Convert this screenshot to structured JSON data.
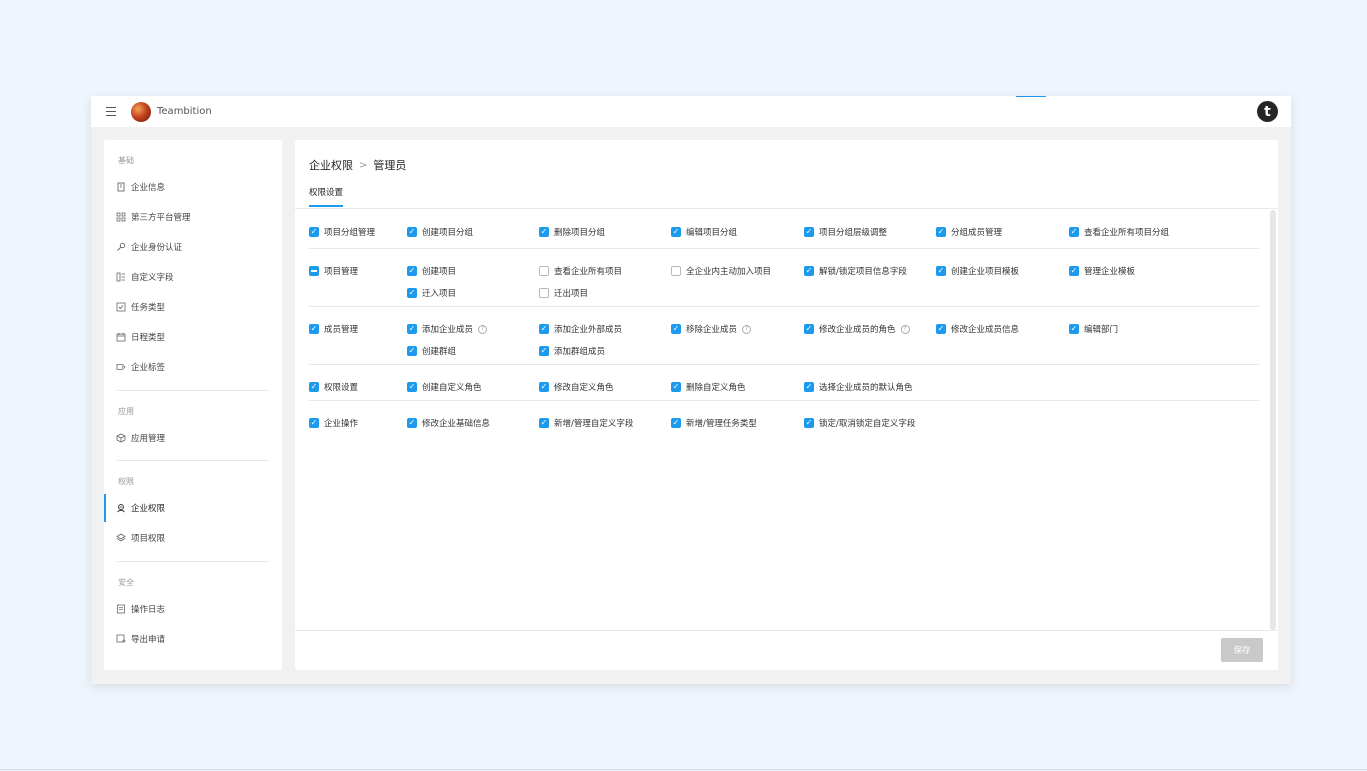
{
  "app": {
    "name": "Teambition",
    "brand_glyph": "t"
  },
  "sidebar": {
    "sections": [
      {
        "title": "基础",
        "items": [
          {
            "label": "企业信息",
            "icon": "building-icon"
          },
          {
            "label": "第三方平台管理",
            "icon": "grid-icon"
          },
          {
            "label": "企业身份认证",
            "icon": "key-icon"
          },
          {
            "label": "自定义字段",
            "icon": "fields-icon"
          },
          {
            "label": "任务类型",
            "icon": "task-check-icon"
          },
          {
            "label": "日程类型",
            "icon": "calendar-icon"
          },
          {
            "label": "企业标签",
            "icon": "tag-icon"
          }
        ]
      },
      {
        "title": "应用",
        "items": [
          {
            "label": "应用管理",
            "icon": "cube-icon"
          }
        ]
      },
      {
        "title": "权限",
        "items": [
          {
            "label": "企业权限",
            "icon": "org-permission-icon",
            "active": true
          },
          {
            "label": "项目权限",
            "icon": "layers-icon"
          }
        ]
      },
      {
        "title": "安全",
        "items": [
          {
            "label": "操作日志",
            "icon": "document-icon"
          },
          {
            "label": "导出申请",
            "icon": "export-icon"
          }
        ]
      }
    ]
  },
  "main": {
    "breadcrumb": {
      "parent": "企业权限",
      "separator": ">",
      "current": "管理员"
    },
    "tab": "权限设置",
    "rows": [
      {
        "group": {
          "label": "项目分组管理",
          "state": "checked"
        },
        "items": [
          {
            "label": "创建项目分组",
            "state": "checked"
          },
          {
            "label": "删除项目分组",
            "state": "checked"
          },
          {
            "label": "编辑项目分组",
            "state": "checked"
          },
          {
            "label": "项目分组层级调整",
            "state": "checked"
          },
          {
            "label": "分组成员管理",
            "state": "checked"
          },
          {
            "label": "查看企业所有项目分组",
            "state": "checked"
          }
        ]
      },
      {
        "group": {
          "label": "项目管理",
          "state": "indeterminate"
        },
        "items": [
          {
            "label": "创建项目",
            "state": "checked"
          },
          {
            "label": "查看企业所有项目",
            "state": "unchecked"
          },
          {
            "label": "全企业内主动加入项目",
            "state": "unchecked"
          },
          {
            "label": "解锁/锁定项目信息字段",
            "state": "checked"
          },
          {
            "label": "创建企业项目模板",
            "state": "checked"
          },
          {
            "label": "管理企业模板",
            "state": "checked"
          },
          {
            "label": "迁入项目",
            "state": "checked"
          },
          {
            "label": "迁出项目",
            "state": "unchecked"
          }
        ]
      },
      {
        "group": {
          "label": "成员管理",
          "state": "checked"
        },
        "items": [
          {
            "label": "添加企业成员",
            "state": "checked",
            "help": true
          },
          {
            "label": "添加企业外部成员",
            "state": "checked"
          },
          {
            "label": "移除企业成员",
            "state": "checked",
            "help": true
          },
          {
            "label": "修改企业成员的角色",
            "state": "checked",
            "help": true
          },
          {
            "label": "修改企业成员信息",
            "state": "checked"
          },
          {
            "label": "编辑部门",
            "state": "checked"
          },
          {
            "label": "创建群组",
            "state": "checked"
          },
          {
            "label": "添加群组成员",
            "state": "checked"
          }
        ]
      },
      {
        "group": {
          "label": "权限设置",
          "state": "checked"
        },
        "items": [
          {
            "label": "创建自定义角色",
            "state": "checked"
          },
          {
            "label": "修改自定义角色",
            "state": "checked"
          },
          {
            "label": "删除自定义角色",
            "state": "checked"
          },
          {
            "label": "选择企业成员的默认角色",
            "state": "checked"
          }
        ]
      },
      {
        "group": {
          "label": "企业操作",
          "state": "checked"
        },
        "items": [
          {
            "label": "修改企业基础信息",
            "state": "checked"
          },
          {
            "label": "新增/管理自定义字段",
            "state": "checked"
          },
          {
            "label": "新增/管理任务类型",
            "state": "checked"
          },
          {
            "label": "锁定/取消锁定自定义字段",
            "state": "checked"
          }
        ]
      }
    ],
    "save_label": "保存",
    "colors": {
      "accent": "#1b9aee",
      "disabled_button": "#c9c9c9"
    }
  }
}
